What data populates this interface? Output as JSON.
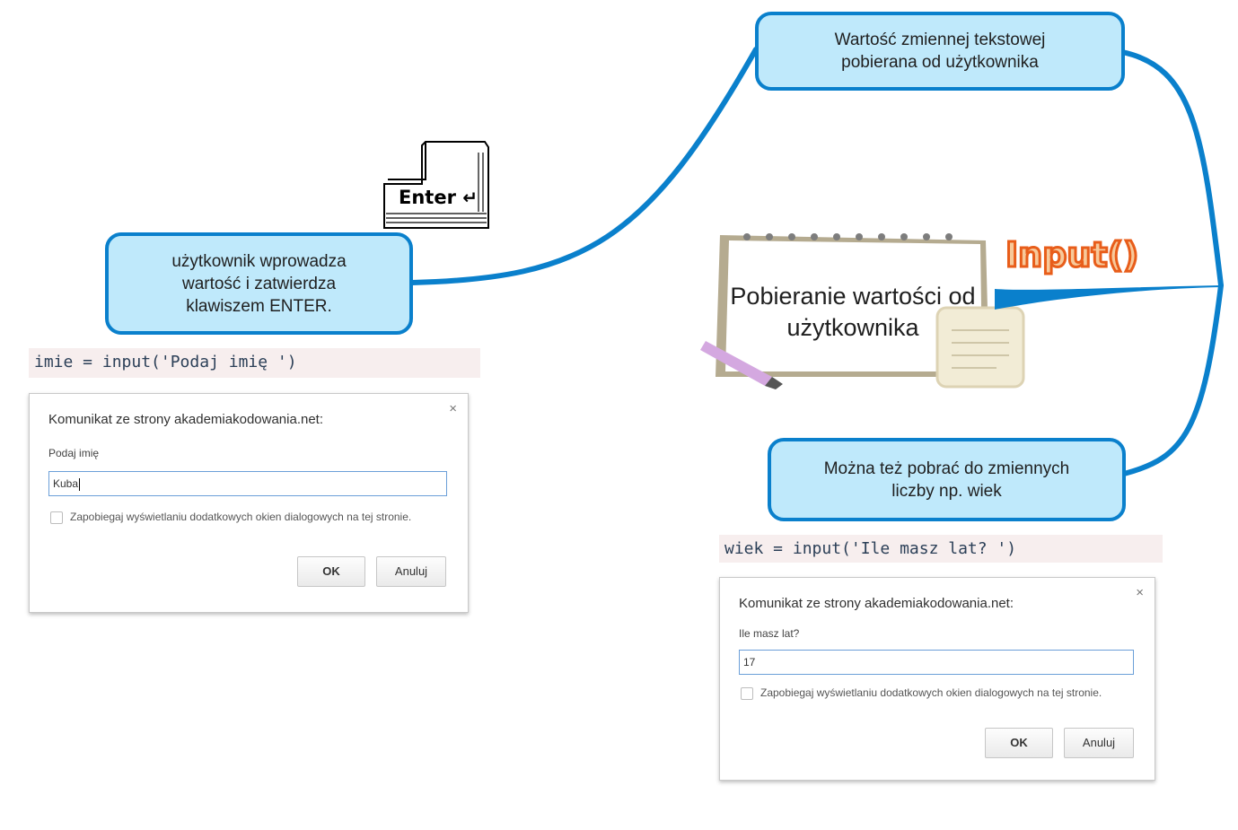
{
  "central_topic": {
    "line1": "Pobieranie wartości od",
    "line2": "użytkownika",
    "logo_text": "Input()"
  },
  "key_icon": {
    "label": "Enter",
    "symbol": "↵"
  },
  "bubbles": {
    "top_right": {
      "lines": [
        "Wartość zmiennej tekstowej",
        "pobierana od użytkownika"
      ]
    },
    "left": {
      "lines": [
        "użytkownik wprowadza",
        "wartość i zatwierdza",
        "klawiszem ENTER."
      ]
    },
    "bottom_right": {
      "lines": [
        "Można też pobrać do zmiennych",
        "liczby np. wiek"
      ]
    }
  },
  "code_left": "imie = input('Podaj imię ')",
  "code_right": "wiek = input('Ile masz lat? ')",
  "dialog_left": {
    "title": "Komunikat ze strony akademiakodowania.net:",
    "close": "×",
    "prompt": "Podaj imię",
    "value": "Kuba",
    "checkbox_label": "Zapobiegaj wyświetlaniu dodatkowych okien dialogowych na tej stronie.",
    "ok_label": "OK",
    "cancel_label": "Anuluj"
  },
  "dialog_right": {
    "title": "Komunikat ze strony akademiakodowania.net:",
    "close": "×",
    "prompt": "Ile masz lat?",
    "value": "17",
    "checkbox_label": "Zapobiegaj wyświetlaniu dodatkowych okien dialogowych na tej stronie.",
    "ok_label": "OK",
    "cancel_label": "Anuluj"
  },
  "colors": {
    "connector": "#0a80cc",
    "bubble_fill": "#bfe9fb",
    "code_bg": "#f7eeee",
    "logo_outline": "#e85d1a"
  }
}
